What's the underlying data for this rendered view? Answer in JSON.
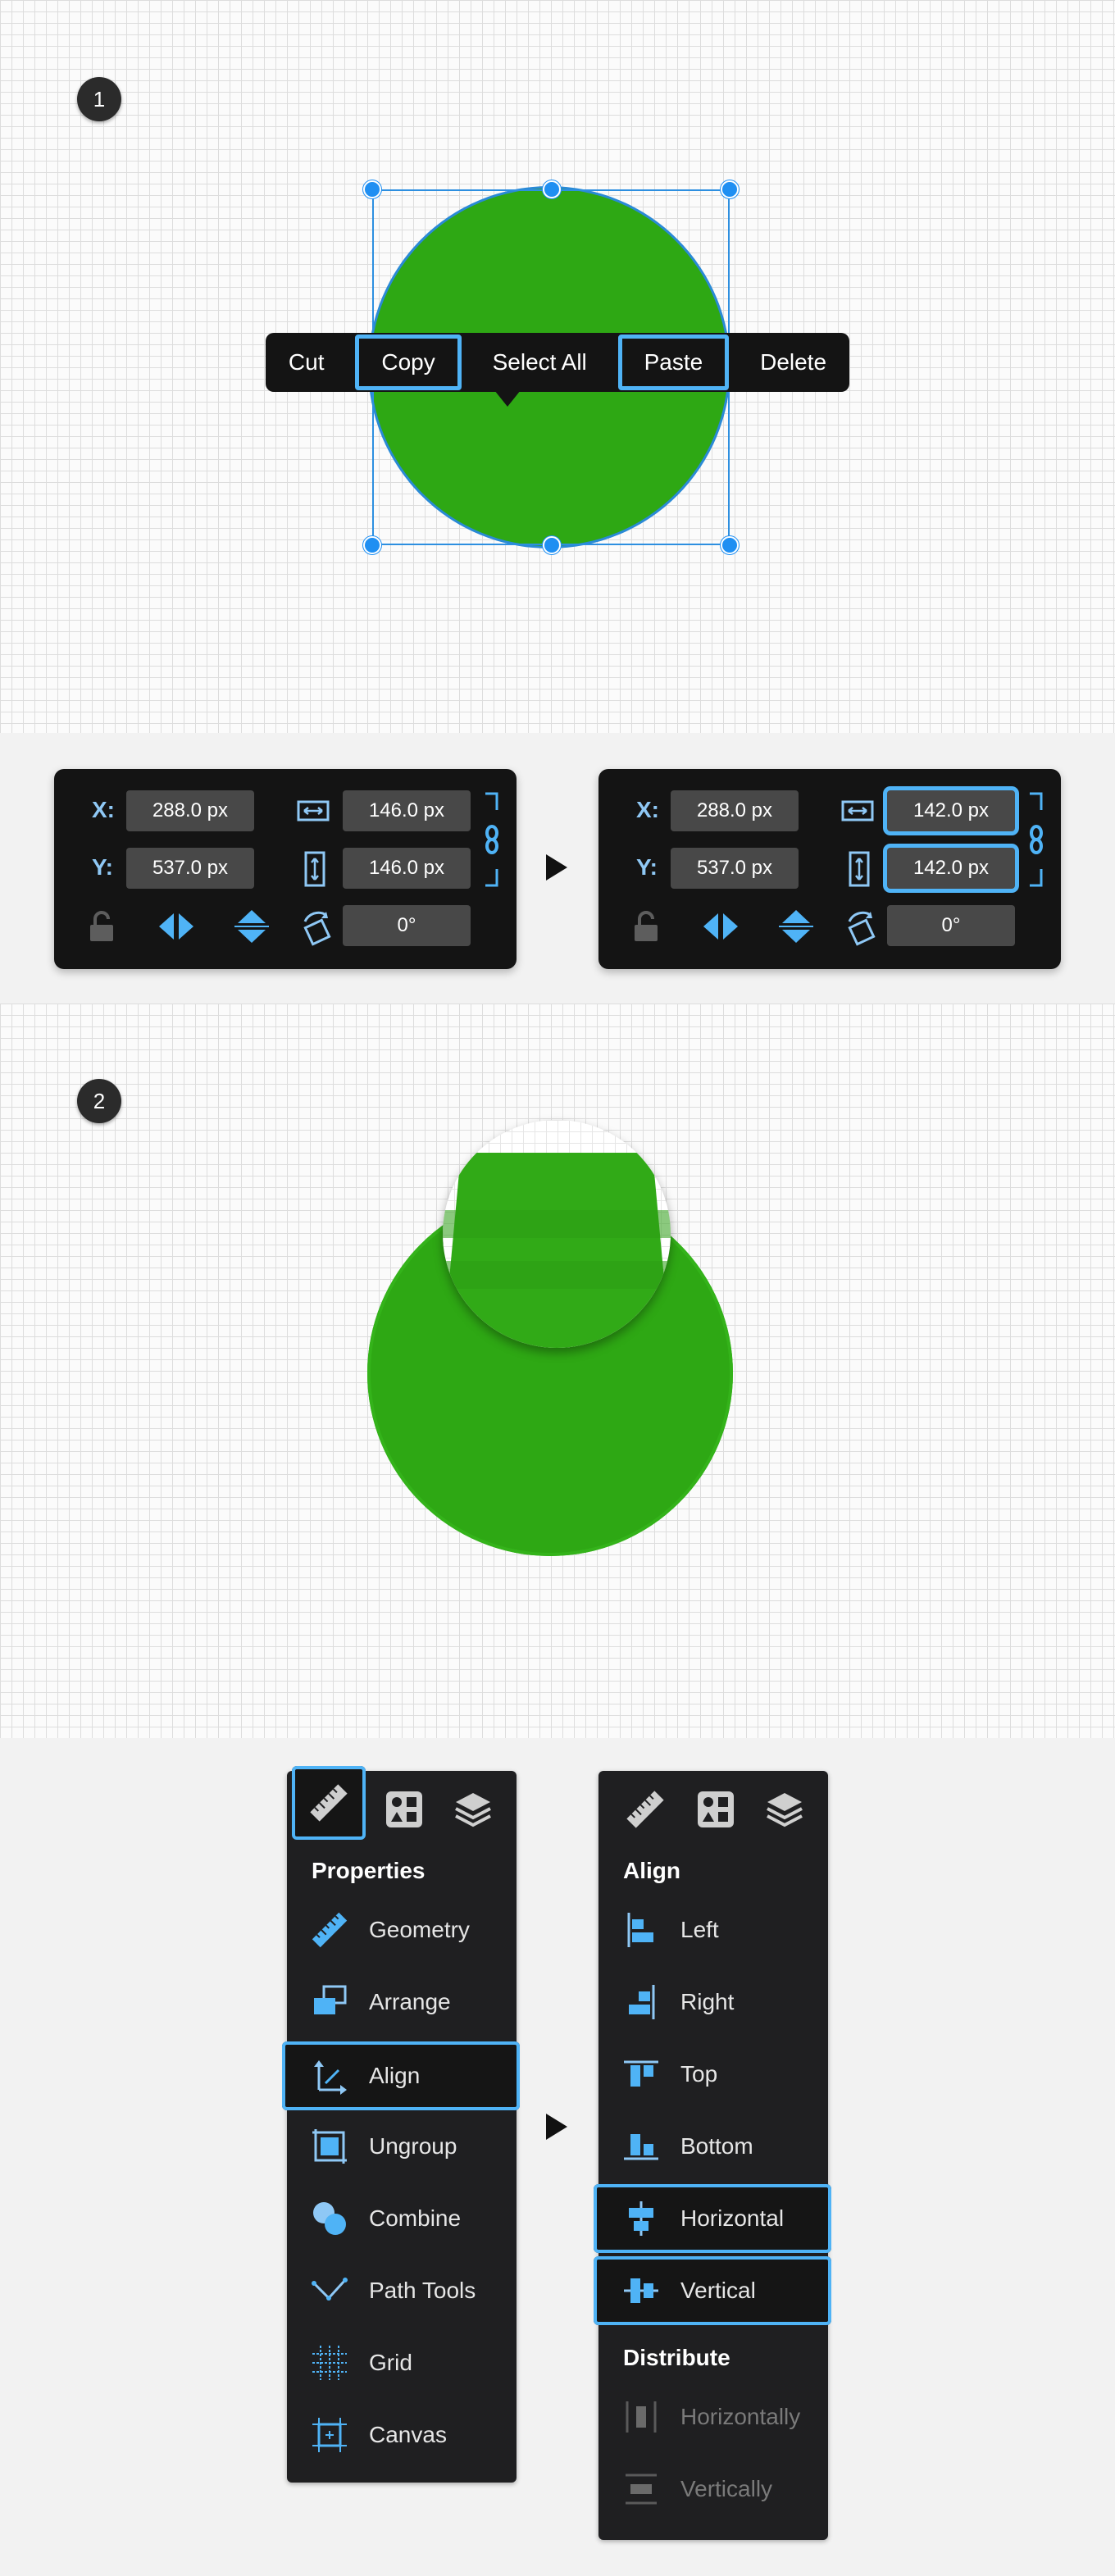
{
  "step1": {
    "badge": "1",
    "shape_color": "#2ea814",
    "context_menu": {
      "items": [
        "Cut",
        "Copy",
        "Select All",
        "Paste",
        "Delete"
      ],
      "highlighted": [
        "Copy",
        "Paste"
      ]
    }
  },
  "transform_panels": {
    "before": {
      "x_label": "X:",
      "y_label": "Y:",
      "x_value": "288.0 px",
      "y_value": "537.0 px",
      "width_value": "146.0 px",
      "height_value": "146.0 px",
      "rotation_value": "0°"
    },
    "after": {
      "x_label": "X:",
      "y_label": "Y:",
      "x_value": "288.0 px",
      "y_value": "537.0 px",
      "width_value": "142.0 px",
      "height_value": "142.0 px",
      "rotation_value": "0°"
    }
  },
  "step2": {
    "badge": "2",
    "shape_color": "#2ea814"
  },
  "properties_panel": {
    "section_title": "Properties",
    "items": [
      "Geometry",
      "Arrange",
      "Align",
      "Ungroup",
      "Combine",
      "Path Tools",
      "Grid",
      "Canvas"
    ],
    "highlighted": "Align"
  },
  "align_panel": {
    "align_title": "Align",
    "align_items": [
      "Left",
      "Right",
      "Top",
      "Bottom",
      "Horizontal",
      "Vertical"
    ],
    "distribute_title": "Distribute",
    "distribute_items": [
      "Horizontally",
      "Vertically"
    ],
    "highlighted": [
      "Horizontal",
      "Vertical"
    ]
  },
  "colors": {
    "accent": "#4fb3f6",
    "handle_blue": "#1f8ff2",
    "panel_bg": "#141414",
    "green": "#2ea814"
  }
}
